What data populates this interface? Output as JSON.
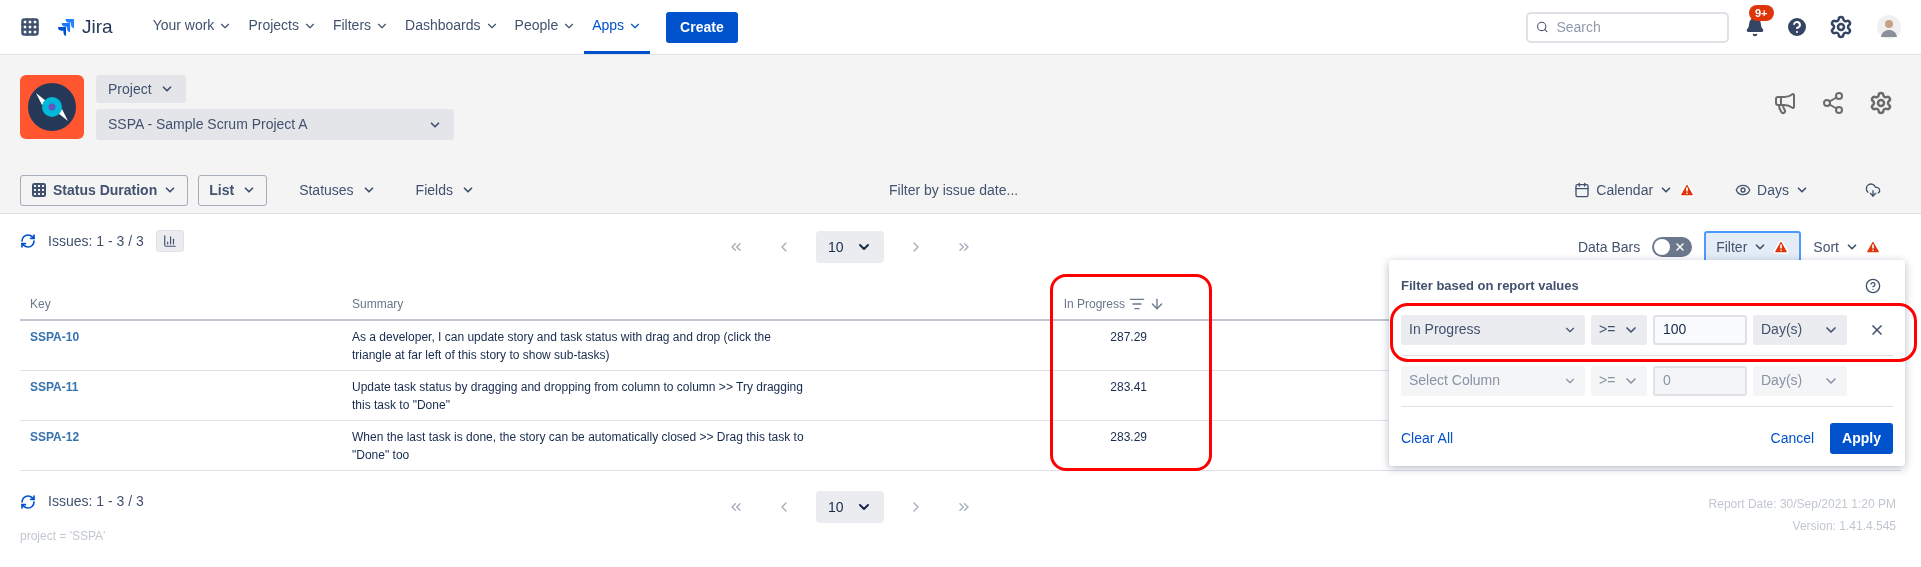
{
  "nav": {
    "app_name": "Jira",
    "items": [
      {
        "label": "Your work",
        "selected": false
      },
      {
        "label": "Projects",
        "selected": false
      },
      {
        "label": "Filters",
        "selected": false
      },
      {
        "label": "Dashboards",
        "selected": false
      },
      {
        "label": "People",
        "selected": false
      },
      {
        "label": "Apps",
        "selected": true
      }
    ],
    "create": "Create",
    "search": {
      "placeholder": "Search"
    },
    "notification_badge": "9+"
  },
  "project": {
    "label": "Project",
    "selected": "SSPA - Sample Scrum Project A"
  },
  "toolbar": {
    "report_type": "Status Duration",
    "view": "List",
    "menus": [
      "Statuses",
      "Fields"
    ],
    "date_filter": "Filter by issue date...",
    "calendar": {
      "label": "Calendar",
      "warning": true
    },
    "days": "Days"
  },
  "issues": {
    "count": "Issues: 1 - 3 / 3"
  },
  "pagination": {
    "page_size": "10"
  },
  "data_bars": {
    "label": "Data Bars",
    "on": false
  },
  "filter_button": {
    "label": "Filter",
    "expanded": true,
    "warning": true
  },
  "sort_button": {
    "label": "Sort",
    "warning": true
  },
  "table": {
    "columns": [
      "Key",
      "Summary",
      "In Progress"
    ],
    "rows": [
      {
        "key": "SSPA-10",
        "summary": "As a developer, I can update story and task status with drag and drop (click the triangle at far left of this story to show sub-tasks)",
        "in_progress": "287.29"
      },
      {
        "key": "SSPA-11",
        "summary": "Update task status by dragging and dropping from column to column >> Try dragging this task to \"Done\"",
        "in_progress": "283.41"
      },
      {
        "key": "SSPA-12",
        "summary": "When the last task is done, the story can be automatically closed >> Drag this task to \"Done\" too",
        "in_progress": "283.29"
      }
    ]
  },
  "filter_popup": {
    "title": "Filter based on report values",
    "rows": [
      {
        "column": "In Progress",
        "operator": ">=",
        "value": "100",
        "unit": "Day(s)",
        "disabled": false
      },
      {
        "column": "Select Column",
        "operator": ">=",
        "value": "0",
        "unit": "Day(s)",
        "disabled": true
      }
    ],
    "clear": "Clear All",
    "cancel": "Cancel",
    "apply": "Apply"
  },
  "footer": {
    "issues": "Issues: 1 - 3 / 3",
    "page_size": "10",
    "query": "project = 'SSPA'",
    "report_date": "Report Date: 30/Sep/2021 1:20 PM",
    "version": "Version: 1.41.4.545"
  }
}
